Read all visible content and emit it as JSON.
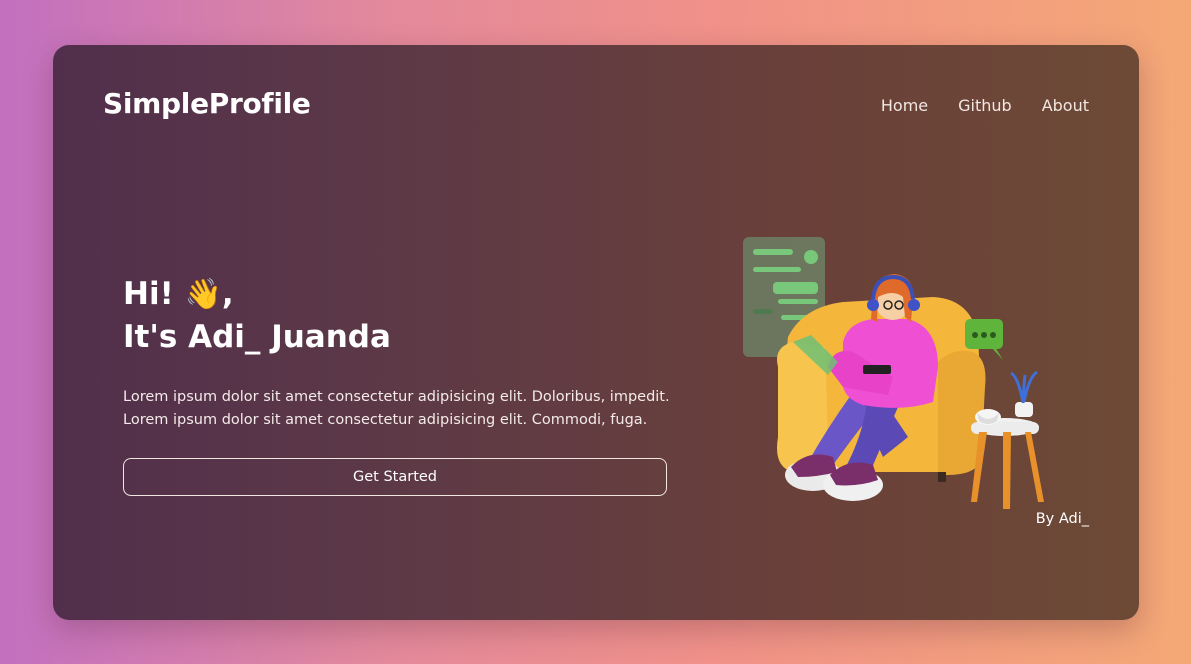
{
  "brand": {
    "name": "SimpleProfile"
  },
  "nav": {
    "items": [
      {
        "label": "Home"
      },
      {
        "label": "Github"
      },
      {
        "label": "About"
      }
    ]
  },
  "hero": {
    "greeting_prefix": "Hi!",
    "greeting_emoji": "👋",
    "greeting_suffix": ",",
    "title": "It's Adi_ Juanda",
    "description_line1": "Lorem ipsum dolor sit amet consectetur adipisicing elit. Doloribus, impedit.",
    "description_line2": "Lorem ipsum dolor sit amet consectetur adipisicing elit. Commodi, fuga.",
    "cta_label": "Get Started"
  },
  "footer": {
    "credit": "By Adi_"
  },
  "colors": {
    "page_gradient": [
      "#c270c0",
      "#f4a876"
    ],
    "card_gradient": [
      "#512f4c",
      "#6d4a36"
    ],
    "text": "#ffffff"
  }
}
